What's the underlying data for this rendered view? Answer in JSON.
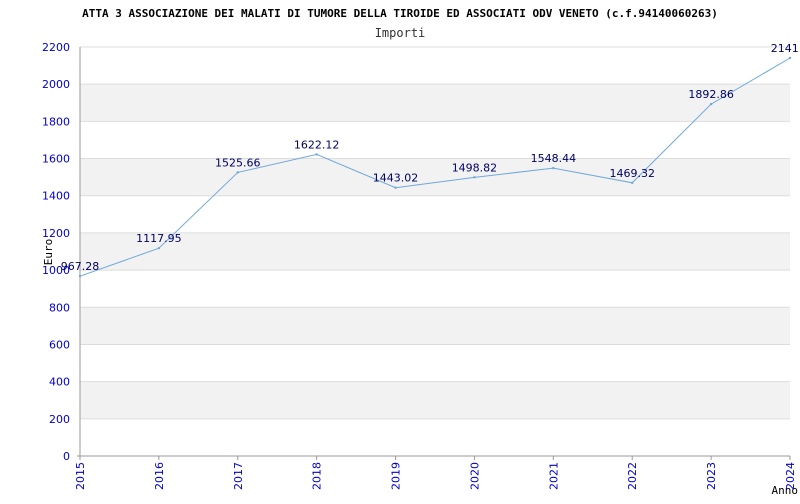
{
  "chart_data": {
    "type": "line",
    "title": "ATTA 3 ASSOCIAZIONE DEI MALATI DI TUMORE DELLA TIROIDE ED ASSOCIATI ODV VENETO (c.f.94140060263)",
    "subtitle": "Importi",
    "xlabel": "Anno",
    "ylabel": "Euro",
    "categories": [
      "2015",
      "2016",
      "2017",
      "2018",
      "2019",
      "2020",
      "2021",
      "2022",
      "2023",
      "2024"
    ],
    "series": [
      {
        "values": [
          967.28,
          1117.95,
          1525.66,
          1622.12,
          1443.02,
          1498.82,
          1548.44,
          1469.32,
          1892.86,
          2141.0
        ],
        "labels": [
          "967.28",
          "1117.95",
          "1525.66",
          "1622.12",
          "1443.02",
          "1498.82",
          "1548.44",
          "1469.32",
          "1892.86",
          "2141.0"
        ]
      }
    ],
    "yticks": [
      "0",
      "200",
      "400",
      "600",
      "800",
      "1000",
      "1200",
      "1400",
      "1600",
      "1800",
      "2000",
      "2200"
    ],
    "ylim": [
      0,
      2200
    ],
    "grid": "horizontal",
    "colors": {
      "line": "#6fa8dc",
      "band": "#f2f2f2",
      "grid": "#dddddd",
      "tick_text": "#0000cc",
      "label_text": "#000066"
    }
  }
}
